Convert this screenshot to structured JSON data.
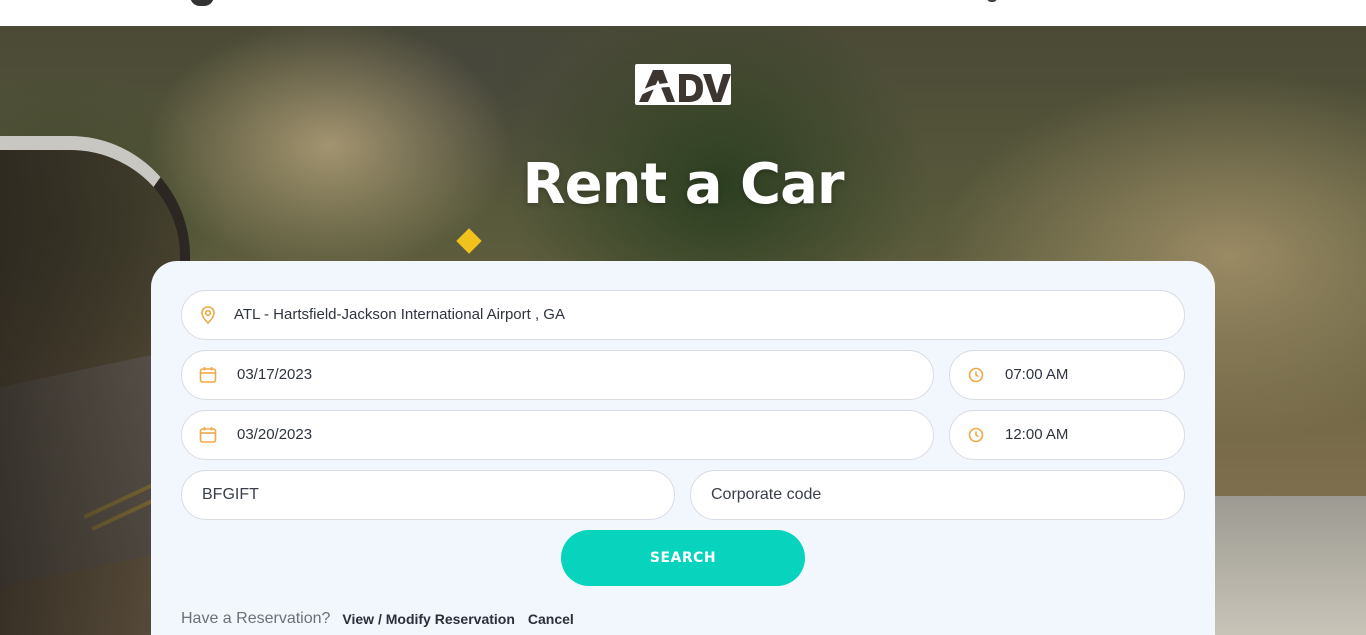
{
  "brand": {
    "logo_text": "Adv"
  },
  "hero": {
    "title": "Rent a Car"
  },
  "form": {
    "location": {
      "value": "ATL - Hartsfield-Jackson International Airport , GA",
      "icon": "map-pin-icon"
    },
    "pickup_date": {
      "value": "03/17/2023",
      "icon": "calendar-icon"
    },
    "pickup_time": {
      "value": "07:00 AM",
      "icon": "clock-icon"
    },
    "return_date": {
      "value": "03/20/2023",
      "icon": "calendar-icon"
    },
    "return_time": {
      "value": "12:00 AM",
      "icon": "clock-icon"
    },
    "promo_code": {
      "value": "BFGIFT"
    },
    "corporate_code": {
      "placeholder": "Corporate code"
    },
    "search_label": "SEARCH"
  },
  "reservation": {
    "question": "Have a Reservation?",
    "view_modify_label": "View / Modify Reservation",
    "cancel_label": "Cancel"
  },
  "colors": {
    "accent": "#08d3bd",
    "icon_orange": "#f0a84a",
    "panel_bg": "#f2f6fd"
  }
}
